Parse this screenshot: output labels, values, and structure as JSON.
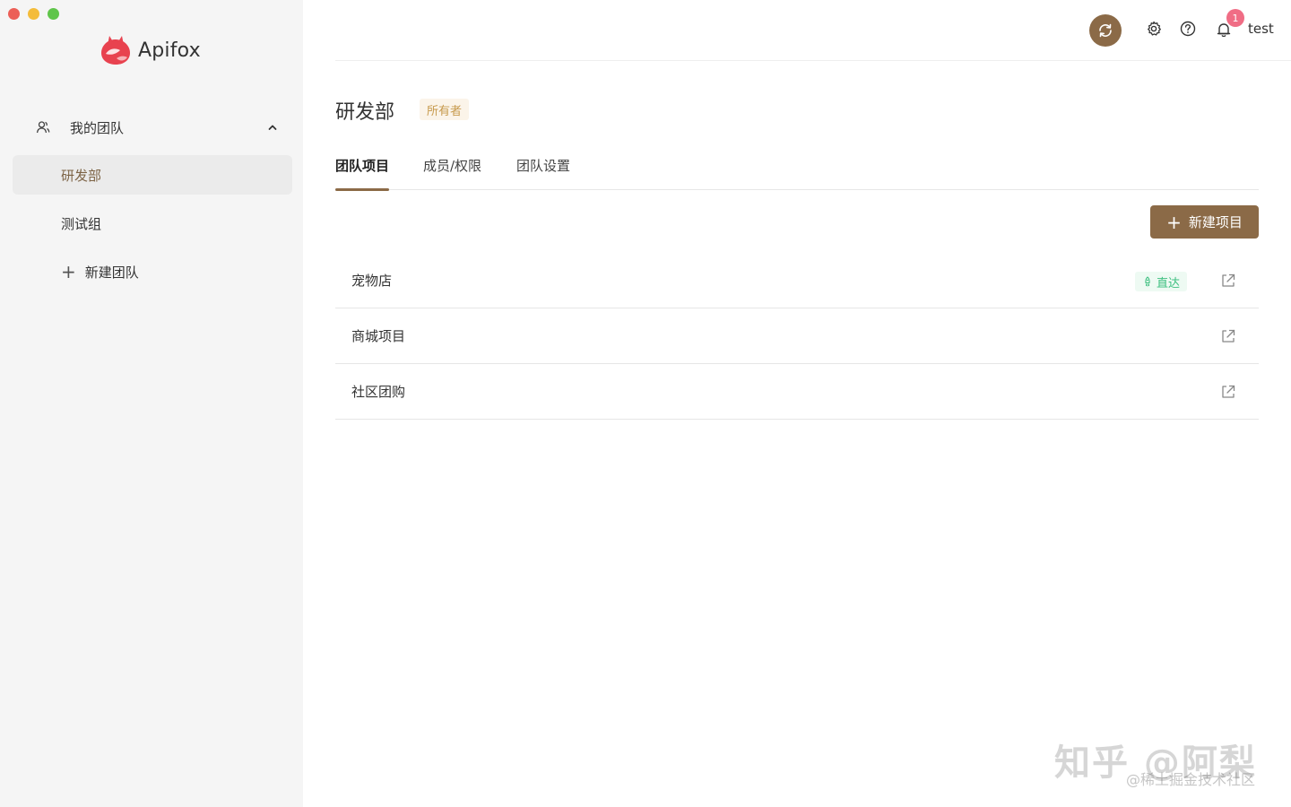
{
  "app": {
    "name": "Apifox"
  },
  "sidebar": {
    "section_label": "我的团队",
    "teams": [
      {
        "label": "研发部",
        "active": true
      },
      {
        "label": "测试组",
        "active": false
      }
    ],
    "add_team_label": "新建团队"
  },
  "topbar": {
    "notification_count": "1",
    "username": "test"
  },
  "team": {
    "name": "研发部",
    "role_tag": "所有者"
  },
  "tabs": [
    {
      "label": "团队项目",
      "active": true
    },
    {
      "label": "成员/权限",
      "active": false
    },
    {
      "label": "团队设置",
      "active": false
    }
  ],
  "new_project_label": "新建项目",
  "projects": [
    {
      "name": "宠物店",
      "tag": "直达"
    },
    {
      "name": "商城项目"
    },
    {
      "name": "社区团购"
    }
  ],
  "watermark": {
    "main": "知乎 @阿梨",
    "sub": "@稀土掘金技术社区"
  },
  "colors": {
    "accent": "#8b6a47",
    "sidebar_bg": "#f5f5f5",
    "badge": "#f06d85",
    "owner_tag_text": "#c79a4d",
    "direct_tag_text": "#3cbf7f"
  }
}
